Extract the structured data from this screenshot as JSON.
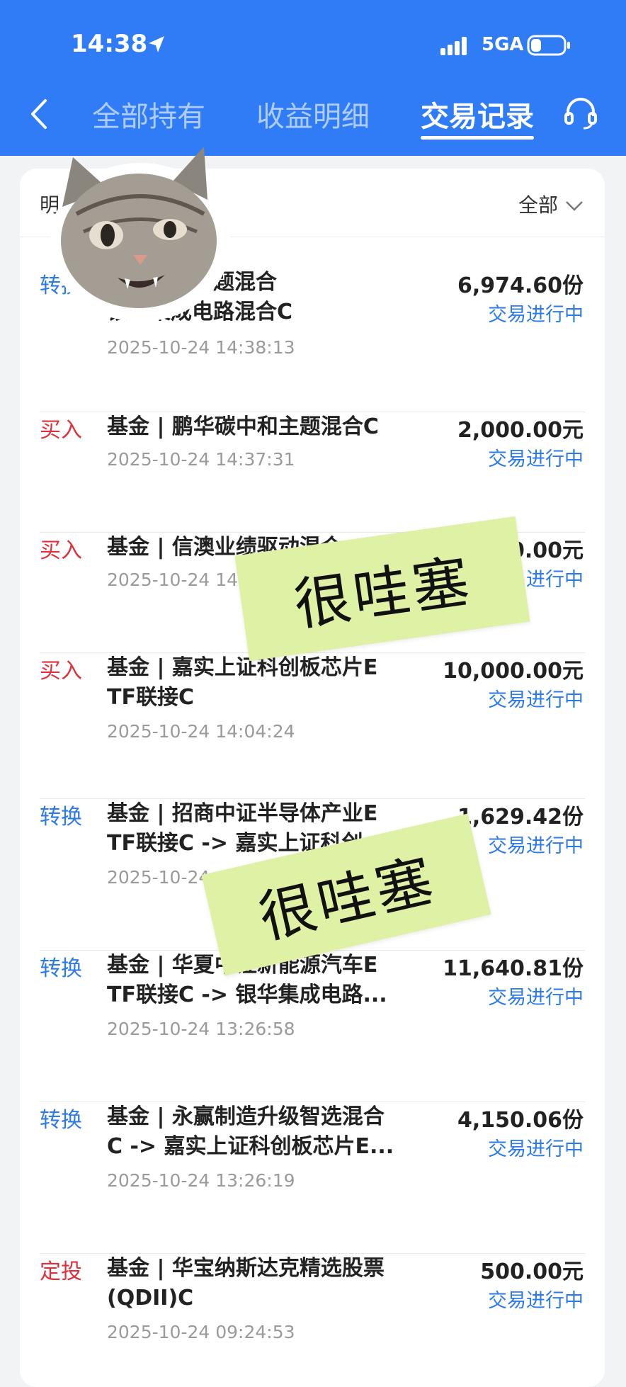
{
  "status_bar": {
    "time": "14:38",
    "network": "5GA"
  },
  "nav": {
    "tabs": [
      {
        "label": "全部持有",
        "active": false
      },
      {
        "label": "收益明细",
        "active": false
      },
      {
        "label": "交易记录",
        "active": true
      }
    ]
  },
  "filter": {
    "left_label": "明",
    "right_label": "全部"
  },
  "records": [
    {
      "type": "转换",
      "kind": "convert",
      "title": "人工智能主题混合",
      "title2": "银华集成电路混合C",
      "date": "2025-10-24 14:38:13",
      "amount": "6,974.60份",
      "status": "交易进行中"
    },
    {
      "type": "买入",
      "kind": "buy",
      "title": "基金 | 鹏华碳中和主题混合C",
      "title2": "",
      "date": "2025-10-24 14:37:31",
      "amount": "2,000.00元",
      "status": "交易进行中"
    },
    {
      "type": "买入",
      "kind": "buy",
      "title": "基金 | 信澳业绩驱动混合",
      "title2": "",
      "date": "2025-10-24 14:0",
      "amount": "0.00元",
      "status": "交易进行中"
    },
    {
      "type": "买入",
      "kind": "buy",
      "title": "基金 | 嘉实上证科创板芯片E",
      "title2": "TF联接C",
      "date": "2025-10-24 14:04:24",
      "amount": "10,000.00元",
      "status": "交易进行中"
    },
    {
      "type": "转换",
      "kind": "convert",
      "title": "基金 | 招商中证半导体产业E",
      "title2": "TF联接C -> 嘉实上证科创",
      "date": "2025-10-24",
      "amount": "1,629.42份",
      "status": "交易进行中"
    },
    {
      "type": "转换",
      "kind": "convert",
      "title": "基金 | 华夏中证新能源汽车E",
      "title2": "TF联接C -> 银华集成电路...",
      "date": "2025-10-24 13:26:58",
      "amount": "11,640.81份",
      "status": "交易进行中"
    },
    {
      "type": "转换",
      "kind": "convert",
      "title": "基金 | 永赢制造升级智选混合",
      "title2": "C -> 嘉实上证科创板芯片E...",
      "date": "2025-10-24 13:26:19",
      "amount": "4,150.06份",
      "status": "交易进行中"
    },
    {
      "type": "定投",
      "kind": "plan",
      "title": "基金 | 华宝纳斯达克精选股票",
      "title2": "(QDII)C",
      "date": "2025-10-24 09:24:53",
      "amount": "500.00元",
      "status": "交易进行中"
    }
  ],
  "stickers": [
    "很哇塞",
    "很哇塞"
  ],
  "colors": {
    "header": "#2f7cf6",
    "buy": "#e0303b",
    "convert": "#2b7ae8",
    "sticker": "#dff1a4"
  }
}
